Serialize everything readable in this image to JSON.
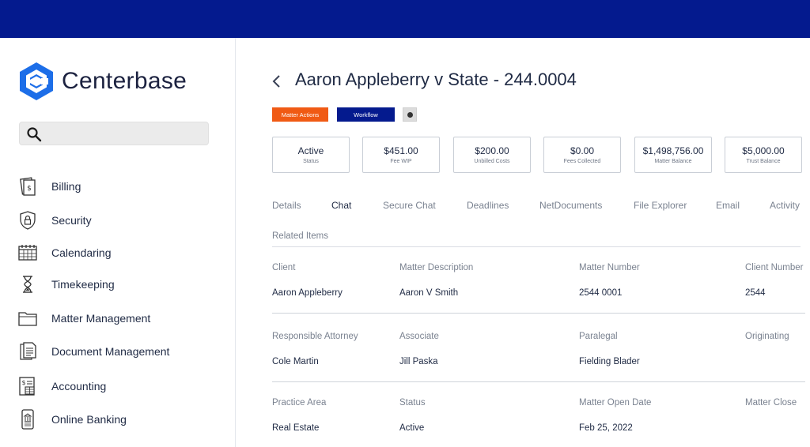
{
  "brand": {
    "name": "Centerbase",
    "color": "#041a8e"
  },
  "search": {
    "placeholder": ""
  },
  "sidebar": {
    "items": [
      {
        "label": "Billing",
        "icon": "billing-icon"
      },
      {
        "label": "Security",
        "icon": "shield-icon"
      },
      {
        "label": "Calendaring",
        "icon": "calendar-icon"
      },
      {
        "label": "Timekeeping",
        "icon": "hourglass-icon"
      },
      {
        "label": "Matter Management",
        "icon": "folder-icon"
      },
      {
        "label": "Document Management",
        "icon": "document-icon"
      },
      {
        "label": "Accounting",
        "icon": "accounting-icon"
      },
      {
        "label": "Online Banking",
        "icon": "bank-phone-icon"
      }
    ]
  },
  "page": {
    "title": "Aaron Appleberry v State - 244.0004",
    "buttons": {
      "matter_actions": "Matter Actions",
      "workflow": "Workflow"
    },
    "cards": [
      {
        "value": "Active",
        "label": "Status"
      },
      {
        "value": "$451.00",
        "label": "Fee WIP"
      },
      {
        "value": "$200.00",
        "label": "Unbilled Costs"
      },
      {
        "value": "$0.00",
        "label": "Fees Collected"
      },
      {
        "value": "$1,498,756.00",
        "label": "Matter Balance"
      },
      {
        "value": "$5,000.00",
        "label": "Trust Balance"
      }
    ],
    "tabs": [
      "Details",
      "Chat",
      "Secure Chat",
      "Deadlines",
      "NetDocuments",
      "File Explorer",
      "Email",
      "Activity"
    ],
    "active_tab": "Chat",
    "related_items": "Related Items",
    "details": {
      "row1": {
        "headers": [
          "Client",
          "Matter Description",
          "Matter Number",
          "Client Number"
        ],
        "values": [
          "Aaron Appleberry",
          "Aaron V Smith",
          "2544 0001",
          "2544"
        ]
      },
      "row2": {
        "headers": [
          "Responsible Attorney",
          "Associate",
          "Paralegal",
          "Originating"
        ],
        "values": [
          "Cole Martin",
          "Jill Paska",
          "Fielding Blader",
          ""
        ]
      },
      "row3": {
        "headers": [
          "Practice Area",
          "Status",
          "Matter Open Date",
          "Matter Close"
        ],
        "values": [
          "Real Estate",
          "Active",
          "Feb 25, 2022",
          ""
        ]
      }
    }
  },
  "colors": {
    "accent_orange": "#f05a14",
    "accent_blue": "#041a8e"
  }
}
